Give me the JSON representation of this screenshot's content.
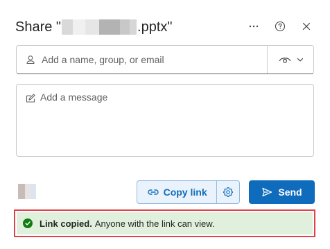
{
  "dialog": {
    "title_prefix": "Share \"",
    "title_suffix": ".pptx\"",
    "more_icon": "ellipsis-icon",
    "help_icon": "question-circle-icon",
    "close_icon": "close-icon"
  },
  "recipient": {
    "placeholder": "Add a name, group, or email",
    "value": "",
    "permission_icon": "eye-icon"
  },
  "message": {
    "placeholder": "Add a message",
    "value": ""
  },
  "actions": {
    "copy_link_label": "Copy link",
    "send_label": "Send"
  },
  "notification": {
    "bold": "Link copied.",
    "text": "Anyone with the link can view."
  },
  "colors": {
    "accent": "#0f6cbd",
    "success": "#107c10",
    "toast_bg": "#e0f0dc",
    "highlight_border": "#e0424a"
  }
}
